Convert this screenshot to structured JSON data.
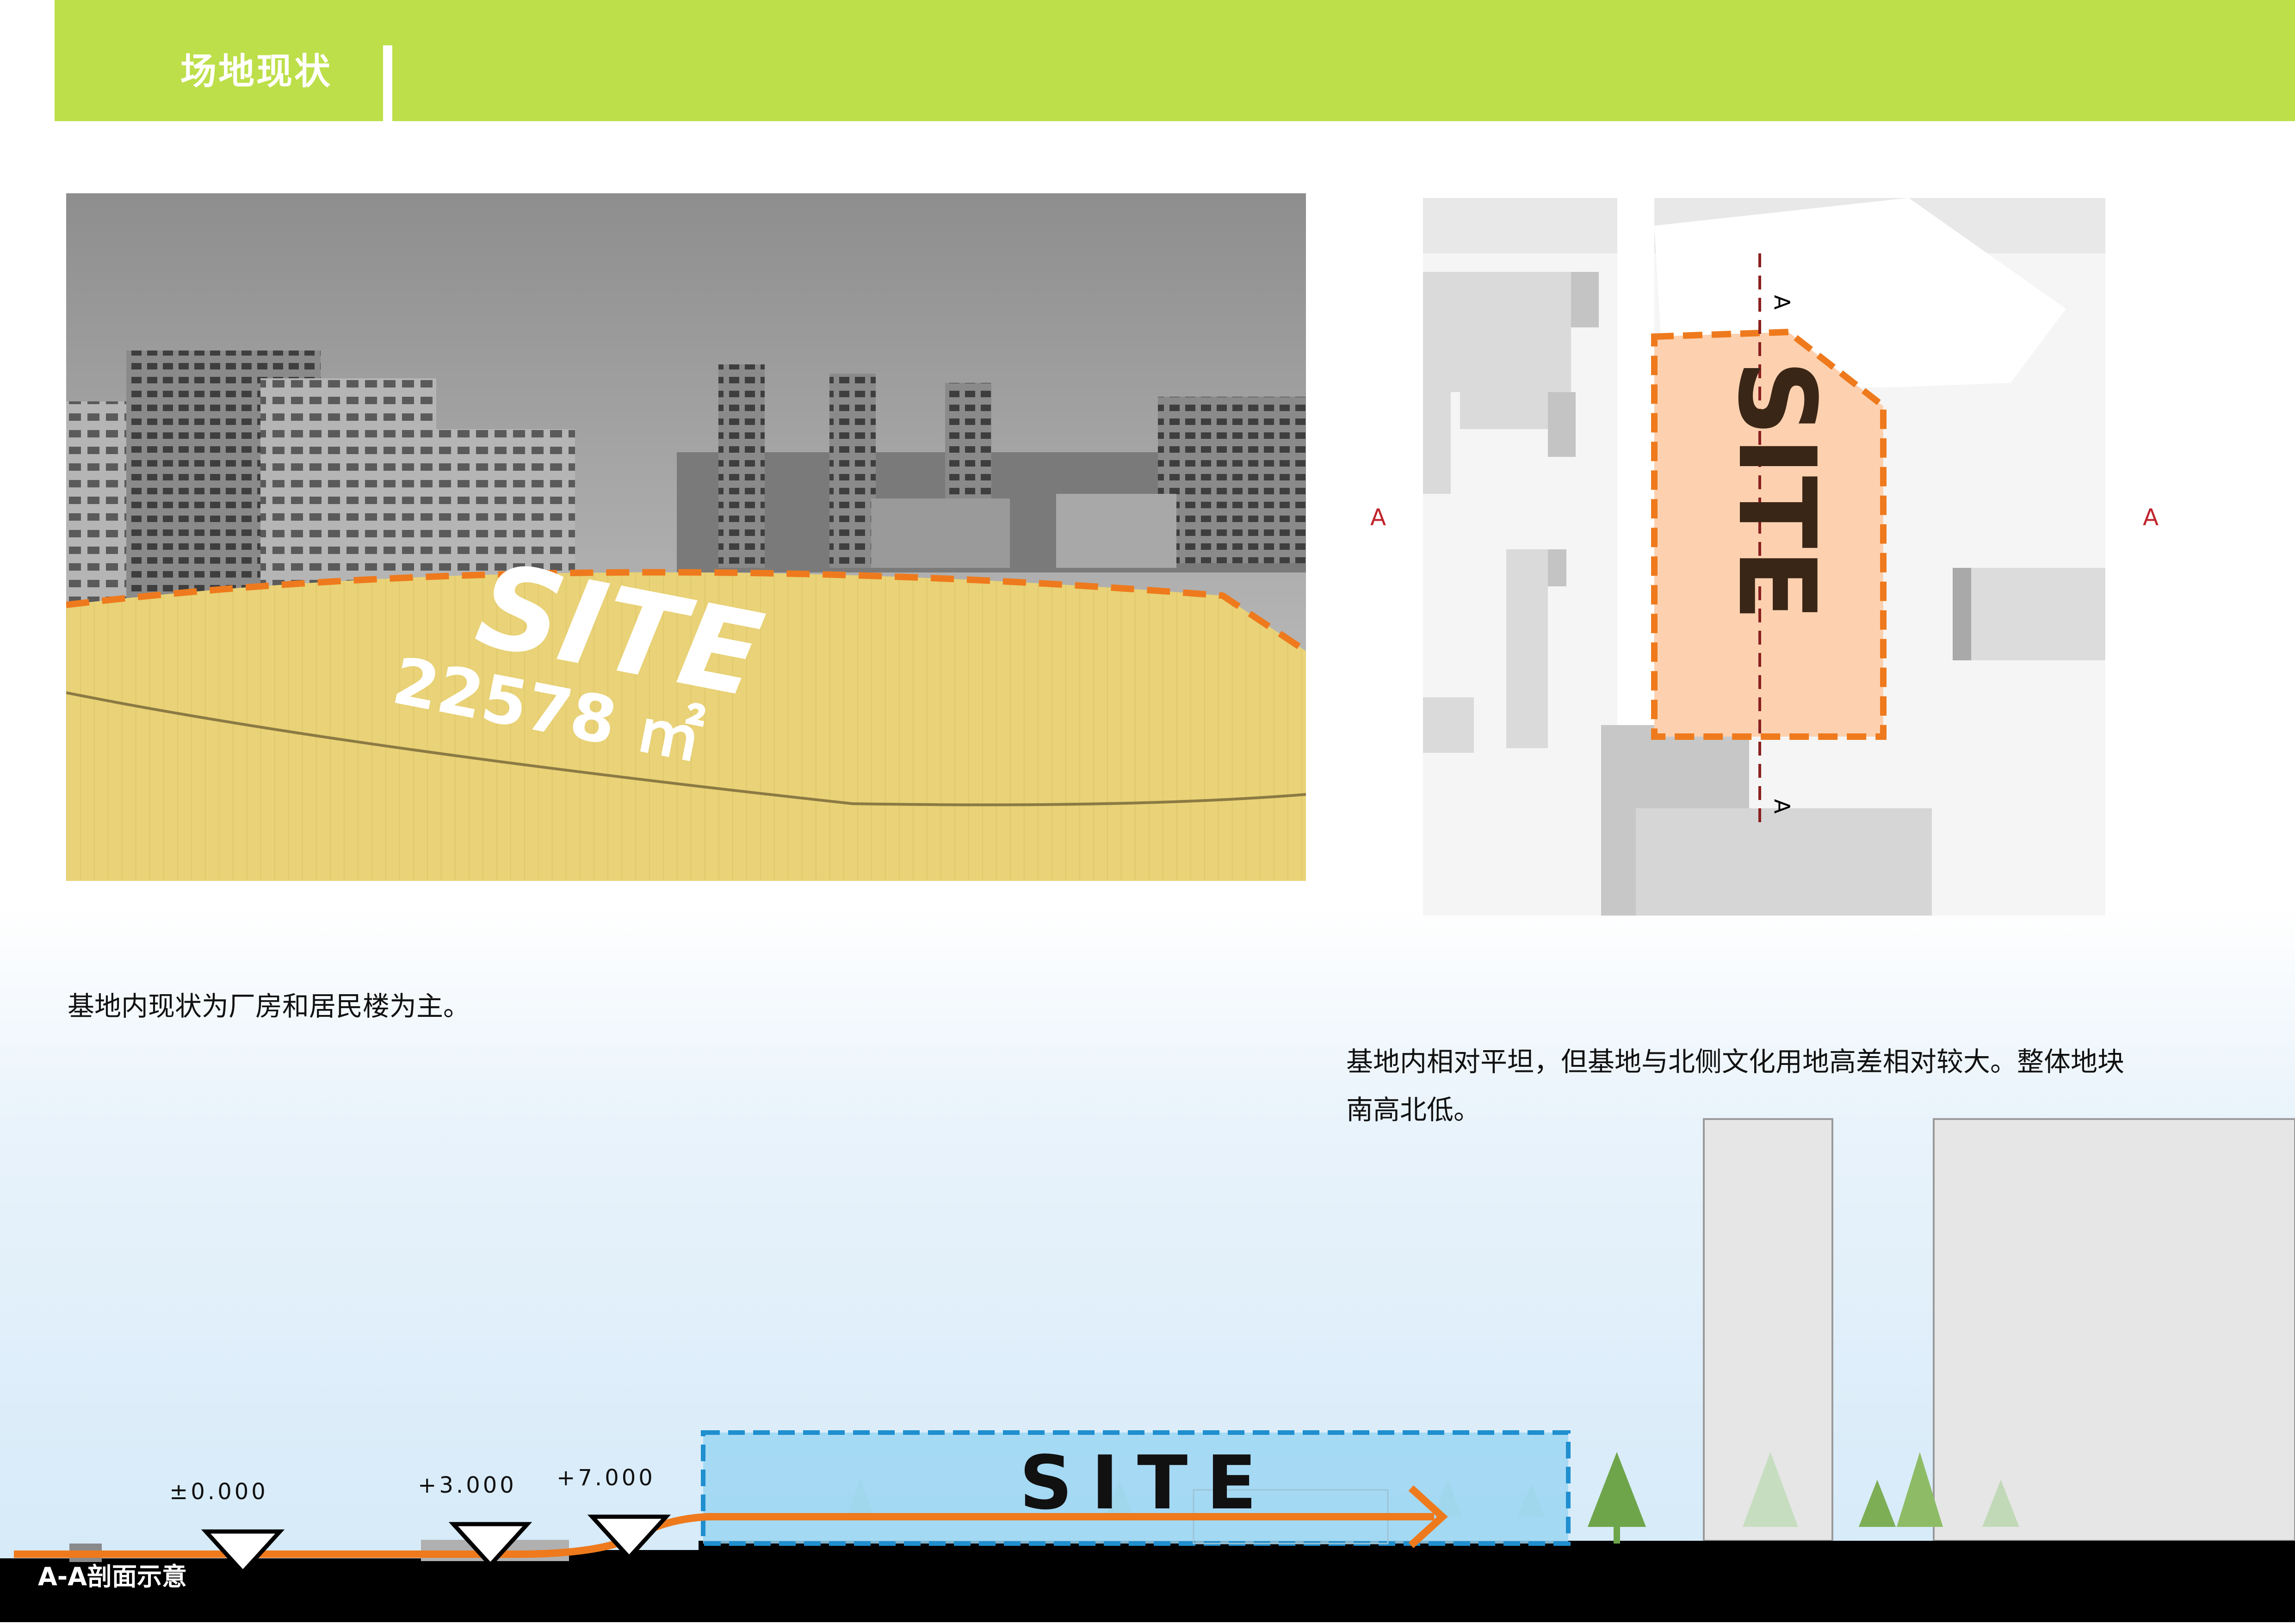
{
  "header": {
    "title": "场地现状"
  },
  "photo": {
    "site_label": "SITE",
    "area_label": "22578 ㎡"
  },
  "plan": {
    "site_label": "SITE",
    "section_mark_top": "A",
    "section_mark_bottom": "A",
    "section_mark_left": "A",
    "section_mark_right": "A"
  },
  "captions": {
    "left": "基地内现状为厂房和居民楼为主。",
    "right_line1": "基地内相对平坦，但基地与北侧文化用地高差相对较大。整体地块",
    "right_line2": "南高北低。"
  },
  "section": {
    "title": "A-A剖面示意",
    "site_label": "SITE",
    "elevations": [
      "±0.000",
      "+3.000",
      "+7.000"
    ]
  },
  "colors": {
    "header_green": "#bddf4a",
    "site_orange": "#ee7a1d",
    "site_fill": "#fdd1b0",
    "site_blue": "#9bd6f3",
    "section_mark_red": "#c0242c"
  }
}
